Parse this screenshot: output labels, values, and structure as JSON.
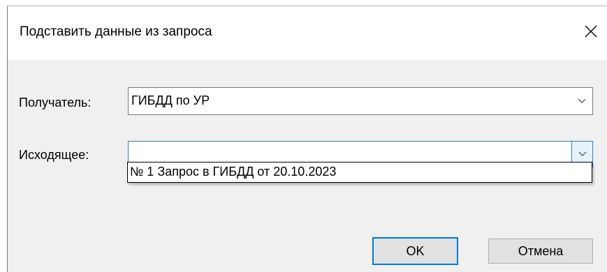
{
  "dialog": {
    "title": "Подставить данные из запроса",
    "close_icon": "close-icon"
  },
  "recipient": {
    "label": "Получатель:",
    "value": "ГИБДД по УР"
  },
  "outgoing": {
    "label": "Исходящее:",
    "value": "",
    "options": [
      "№ 1 Запрос в ГИБДД от 20.10.2023"
    ]
  },
  "buttons": {
    "ok": "OK",
    "cancel": "Отмена"
  },
  "colors": {
    "accent": "#0078d7",
    "dialog_bg": "#f0f0f0",
    "focus_border": "#3c7fb1"
  }
}
